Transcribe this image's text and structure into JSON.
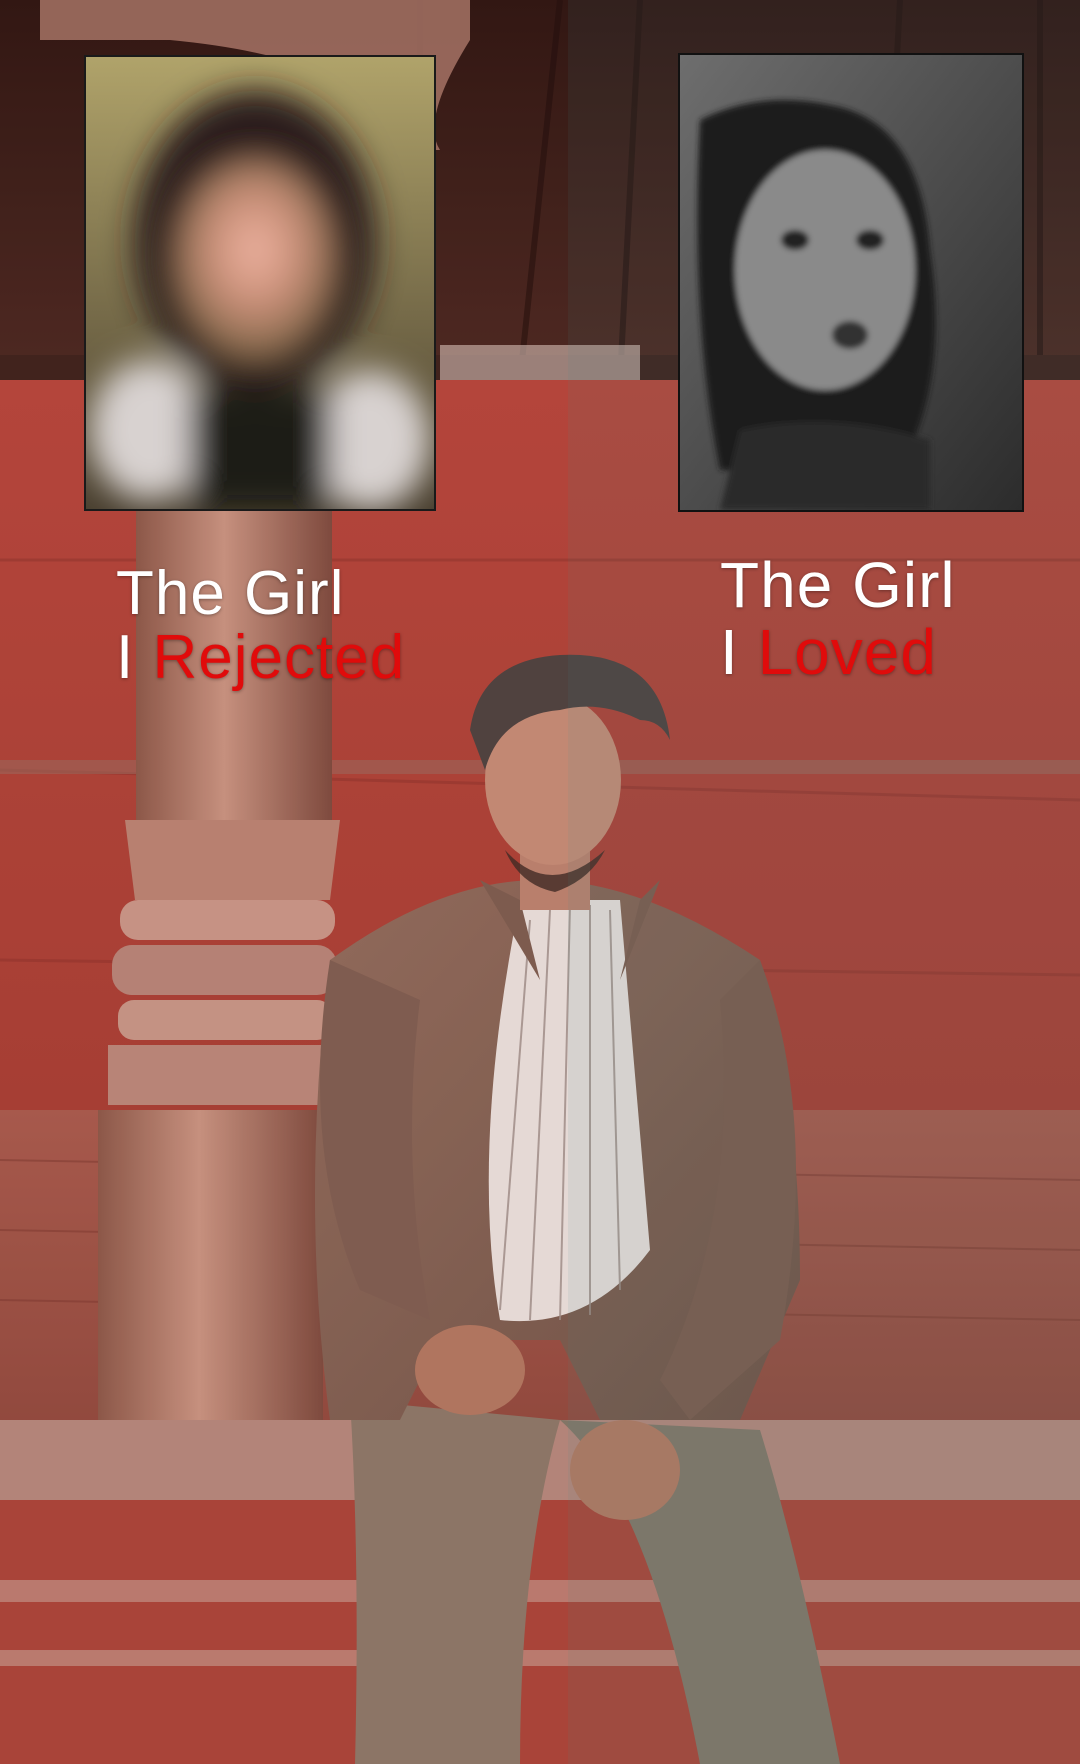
{
  "left_caption": {
    "line1": "The Girl",
    "prefix": "I",
    "highlight": "Rejected"
  },
  "right_caption": {
    "line1": "The Girl",
    "prefix": "I",
    "highlight": "Loved"
  },
  "colors": {
    "caption_text": "#ffffff",
    "caption_highlight": "#e00b0b",
    "wall": "#b2443a",
    "left_tint": "#c0392b"
  }
}
